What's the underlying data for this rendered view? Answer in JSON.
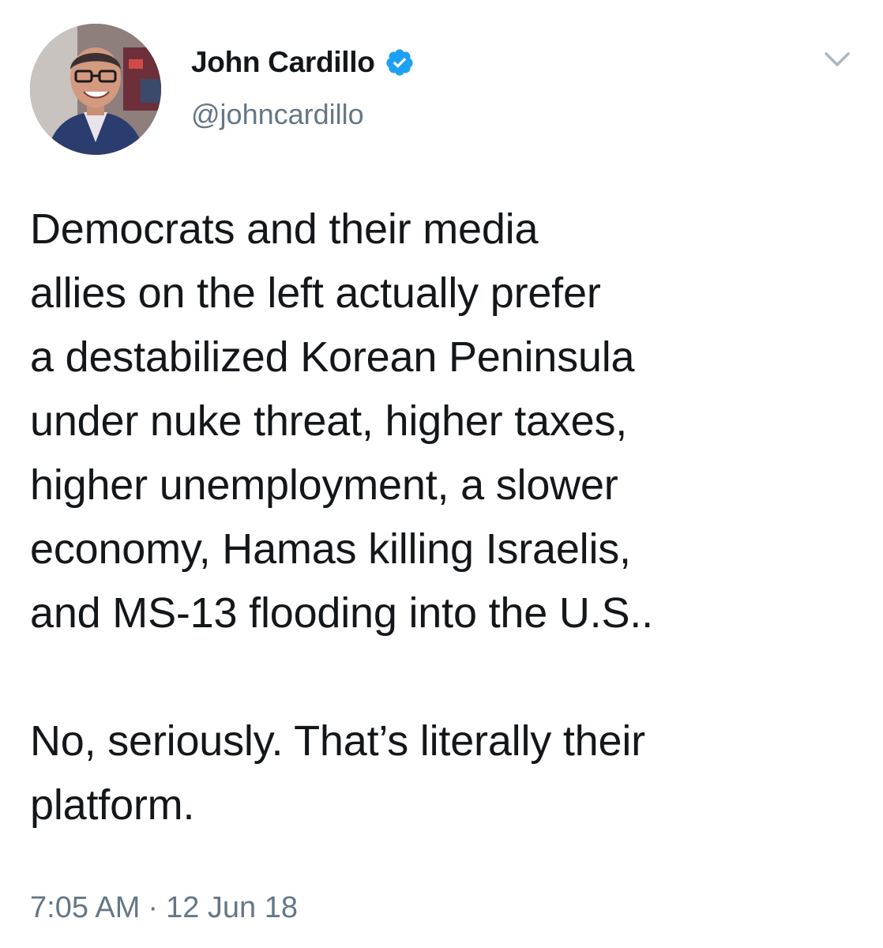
{
  "tweet": {
    "author": {
      "display_name": "John Cardillo",
      "handle": "@johncardillo",
      "verified": true,
      "avatar_icon": "profile-photo"
    },
    "text": "Democrats and their media\nallies on the left actually prefer\na destabilized Korean Peninsula\nunder nuke threat, higher taxes,\nhigher unemployment, a slower\neconomy, Hamas killing Israelis,\nand MS-13 flooding into the U.S..\n\nNo, seriously. That’s literally their\nplatform.",
    "time": "7:05 AM",
    "separator": "·",
    "date": "12 Jun 18",
    "menu_icon": "chevron-down-icon"
  },
  "colors": {
    "text": "#14171a",
    "secondary": "#657786",
    "verified": "#1da1f2",
    "chevron": "#aab8c2"
  }
}
